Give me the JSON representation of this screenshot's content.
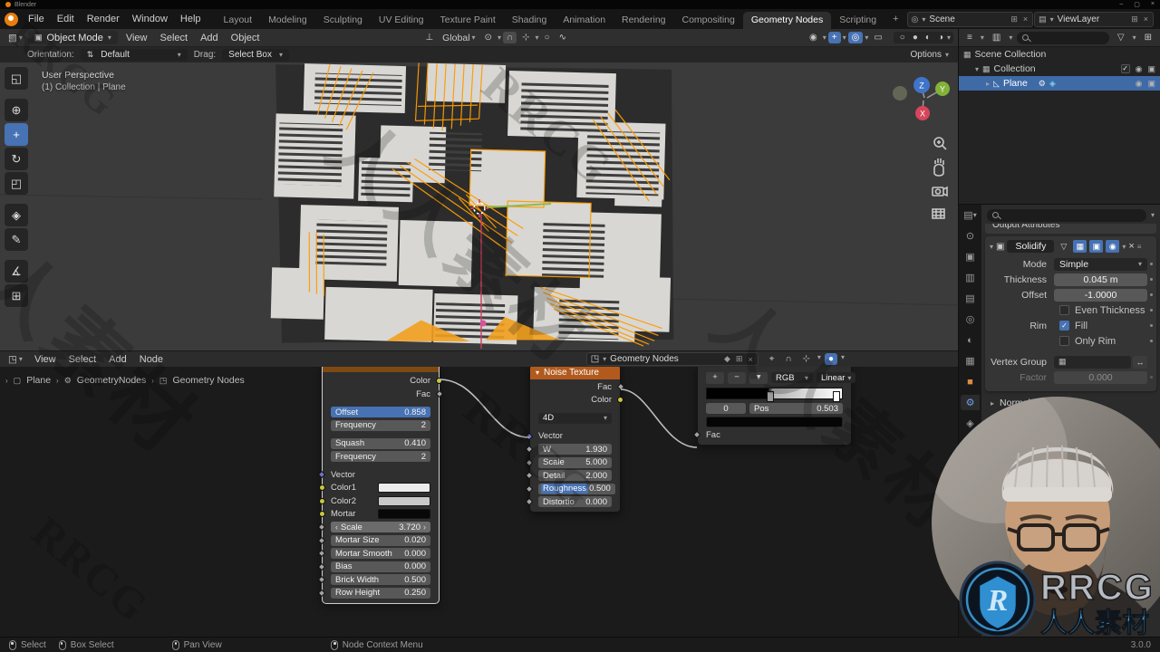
{
  "titlebar": {
    "app": "Blender",
    "min": "–",
    "max": "▢",
    "close": "×"
  },
  "topbar": {
    "menus": [
      "File",
      "Edit",
      "Render",
      "Window",
      "Help"
    ],
    "workspaces": [
      "Layout",
      "Modeling",
      "Sculpting",
      "UV Editing",
      "Texture Paint",
      "Shading",
      "Animation",
      "Rendering",
      "Compositing",
      "Geometry Nodes",
      "Scripting"
    ],
    "active_workspace": "Geometry Nodes",
    "add_tab": "+",
    "scene_label": "Scene",
    "viewlayer_label": "ViewLayer"
  },
  "vp_header": {
    "mode": "Object Mode",
    "menus": [
      "View",
      "Select",
      "Add",
      "Object"
    ],
    "orientation": "Global"
  },
  "tool_settings": {
    "orientation_label": "Orientation:",
    "orientation_value": "Default",
    "drag_label": "Drag:",
    "drag_value": "Select Box",
    "options_label": "Options"
  },
  "viewport": {
    "persp": "User Perspective",
    "coll": "(1) Collection | Plane",
    "axis_x": "X",
    "axis_y": "Y",
    "axis_z": "Z"
  },
  "tools": [
    {
      "name": "tool-select-box",
      "glyph": "◱"
    },
    {
      "name": "tool-cursor",
      "glyph": "⊕"
    },
    {
      "name": "tool-move",
      "glyph": "+",
      "active": true
    },
    {
      "name": "tool-rotate",
      "glyph": "↻"
    },
    {
      "name": "tool-scale",
      "glyph": "◰"
    },
    {
      "name": "tool-transform",
      "glyph": "◈"
    },
    {
      "name": "tool-annotate",
      "glyph": "✎"
    },
    {
      "name": "tool-measure",
      "glyph": "∡"
    },
    {
      "name": "tool-add-cube",
      "glyph": "⊞"
    }
  ],
  "node_header": {
    "menus": [
      "View",
      "Select",
      "Add",
      "Node"
    ],
    "datablock": "Geometry Nodes"
  },
  "breadcrumb": {
    "object": "Plane",
    "modifier": "GeometryNodes",
    "tree": "Geometry Nodes",
    "sep": "›"
  },
  "nodes": {
    "brick": {
      "out_color": "Color",
      "out_fac": "Fac",
      "pairs": [
        {
          "label": "Offset",
          "value": "0.858"
        },
        {
          "label": "Frequency",
          "value": "2"
        },
        {
          "label": "Squash",
          "value": "0.410"
        },
        {
          "label": "Frequency",
          "value": "2"
        }
      ],
      "vector": "Vector",
      "colors": [
        {
          "label": "Color1"
        },
        {
          "label": "Color2"
        },
        {
          "label": "Mortar"
        }
      ],
      "scale_label": "Scale",
      "scale_value": "3.720",
      "arrow_left": "‹",
      "arrow_right": "›",
      "sliders": [
        {
          "label": "Mortar Size",
          "value": "0.020"
        },
        {
          "label": "Mortar Smooth",
          "value": "0.000"
        },
        {
          "label": "Bias",
          "value": "0.000"
        },
        {
          "label": "Brick Width",
          "value": "0.500"
        },
        {
          "label": "Row Height",
          "value": "0.250"
        }
      ]
    },
    "noise": {
      "title": "Noise Texture",
      "out_fac": "Fac",
      "out_color": "Color",
      "dims": "4D",
      "vector": "Vector",
      "w_label": "W",
      "w_value": "1.930",
      "scale_label": "Scale",
      "scale_value": "5.000",
      "detail_label": "Detail",
      "detail_value": "2.000",
      "rough_label": "Roughness",
      "rough_value": "0.500",
      "dist_label": "Distortio",
      "dist_value": "0.000"
    },
    "ramp": {
      "add": "+",
      "remove": "−",
      "mode": "RGB",
      "interp": "Linear",
      "index": "0",
      "pos_label": "Pos",
      "pos_value": "0.503",
      "in_fac": "Fac"
    }
  },
  "outliner": {
    "scene_collection": "Scene Collection",
    "collection": "Collection",
    "object": "Plane"
  },
  "properties": {
    "clipped_panel": "Output Attributes",
    "solidify": {
      "name": "Solidify",
      "mode_label": "Mode",
      "mode_value": "Simple",
      "thickness_label": "Thickness",
      "thickness_value": "0.045 m",
      "offset_label": "Offset",
      "offset_value": "-1.0000",
      "even_label": "Even Thickness",
      "rim_label": "Rim",
      "fill_label": "Fill",
      "only_rim_label": "Only Rim",
      "vgroup_label": "Vertex Group",
      "factor_label": "Factor",
      "factor_value": "0.000"
    },
    "normals": "Normals"
  },
  "props_tabs": [
    {
      "name": "tab-tool",
      "glyph": "⊙"
    },
    {
      "name": "tab-render",
      "glyph": "▣"
    },
    {
      "name": "tab-output",
      "glyph": "▥"
    },
    {
      "name": "tab-view-layer",
      "glyph": "▤"
    },
    {
      "name": "tab-scene",
      "glyph": "◎"
    },
    {
      "name": "tab-world",
      "glyph": "◐"
    },
    {
      "name": "tab-collection",
      "glyph": "▦"
    },
    {
      "name": "tab-object",
      "glyph": "■"
    },
    {
      "name": "tab-modifiers",
      "glyph": "⚙",
      "active": true
    },
    {
      "name": "tab-particles",
      "glyph": "◈"
    },
    {
      "name": "tab-physics",
      "glyph": "○"
    }
  ],
  "status": {
    "hints": [
      "Select",
      "Box Select",
      "Pan View",
      "Node Context Menu"
    ],
    "version": "3.0.0"
  },
  "brand": {
    "rrcg": "RRCG",
    "cn": "人人素材"
  }
}
